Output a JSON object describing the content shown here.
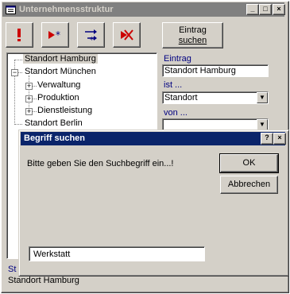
{
  "window": {
    "title": "Unternehmensstruktur",
    "buttons": {
      "minimize": "_",
      "maximize": "□",
      "close": "×"
    }
  },
  "toolbar": {
    "icons": [
      "exclamation-icon",
      "arrow-right-star-icon",
      "swap-arrows-star-icon",
      "remove-arrow-icon"
    ],
    "search_button": {
      "line1": "Eintrag",
      "line2": "suchen"
    }
  },
  "tree": {
    "items": [
      {
        "label": "Standort Hamburg",
        "level": 0,
        "expander": "",
        "selected": true
      },
      {
        "label": "Standort München",
        "level": 0,
        "expander": "−"
      },
      {
        "label": "Verwaltung",
        "level": 1,
        "expander": "+"
      },
      {
        "label": "Produktion",
        "level": 1,
        "expander": "+"
      },
      {
        "label": "Dienstleistung",
        "level": 1,
        "expander": "+"
      },
      {
        "label": "Standort Berlin",
        "level": 0,
        "expander": ""
      }
    ]
  },
  "details": {
    "eintrag_label": "Eintrag",
    "eintrag_value": "Standort Hamburg",
    "ist_label": "ist ...",
    "ist_value": "Standort",
    "von_label": "von ...",
    "von_value": ""
  },
  "status": {
    "label": "St",
    "value": "Standort Hamburg"
  },
  "dialog": {
    "title": "Begriff suchen",
    "help": "?",
    "close": "×",
    "prompt": "Bitte geben Sie den Suchbegriff ein...!",
    "ok_label": "OK",
    "cancel_label": "Abbrechen",
    "input_value": "Werkstatt"
  },
  "colors": {
    "face": "#d4d0c8",
    "active_title": "#0a246a",
    "inactive_title": "#808080",
    "accent_red": "#cc0000",
    "accent_blue": "#000080"
  }
}
